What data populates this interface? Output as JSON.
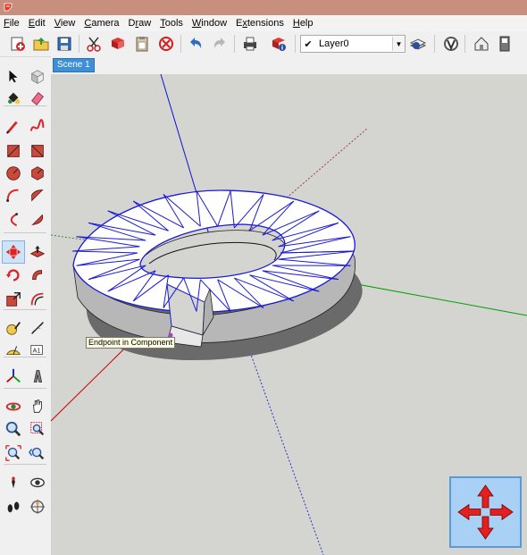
{
  "window": {
    "app_icon": "sketchup-icon"
  },
  "menu": [
    {
      "label": "File",
      "key": "F"
    },
    {
      "label": "Edit",
      "key": "E"
    },
    {
      "label": "View",
      "key": "V"
    },
    {
      "label": "Camera",
      "key": "C"
    },
    {
      "label": "Draw",
      "key": "r"
    },
    {
      "label": "Tools",
      "key": "T"
    },
    {
      "label": "Window",
      "key": "W"
    },
    {
      "label": "Extensions",
      "key": "x"
    },
    {
      "label": "Help",
      "key": "H"
    }
  ],
  "toolbar": {
    "buttons": [
      {
        "icon": "new-model-icon"
      },
      {
        "icon": "open-folder-icon"
      },
      {
        "icon": "save-icon"
      },
      {
        "icon": "cut-icon"
      },
      {
        "icon": "copy-icon"
      },
      {
        "icon": "paste-icon"
      },
      {
        "icon": "erase-icon"
      },
      {
        "icon": "undo-icon"
      },
      {
        "icon": "redo-icon"
      },
      {
        "icon": "print-icon"
      },
      {
        "icon": "model-info-icon"
      }
    ],
    "layer": {
      "current": "Layer0",
      "checked": true
    },
    "right_buttons": [
      {
        "icon": "layer-manager-icon"
      },
      {
        "icon": "vray-icon"
      },
      {
        "icon": "warehouse-icon"
      },
      {
        "icon": "extension-icon"
      }
    ]
  },
  "left_tools": [
    [
      "select-icon",
      "make-component-icon"
    ],
    [
      "paint-bucket-icon",
      "eraser-icon"
    ],
    [
      "pencil-line-icon",
      "freehand-icon"
    ],
    [
      "rectangle-icon",
      "rotated-rectangle-icon"
    ],
    [
      "circle-icon",
      "polygon-icon"
    ],
    [
      "arc-icon",
      "two-point-arc-icon"
    ],
    [
      "three-point-arc-icon",
      "pie-icon"
    ],
    [
      "move-icon",
      "push-pull-icon"
    ],
    [
      "rotate-icon",
      "follow-me-icon"
    ],
    [
      "scale-icon",
      "offset-icon"
    ],
    [
      "tape-measure-icon",
      "dimension-icon"
    ],
    [
      "protractor-icon",
      "text-icon"
    ],
    [
      "axes-icon",
      "3d-text-icon"
    ],
    [
      "orbit-icon",
      "pan-icon"
    ],
    [
      "zoom-icon",
      "zoom-window-icon"
    ],
    [
      "zoom-extents-icon",
      "previous-view-icon"
    ],
    [
      "position-camera-icon",
      "look-around-icon"
    ],
    [
      "walk-icon",
      "section-plane-icon"
    ]
  ],
  "active_tool": "move-icon",
  "scene": {
    "tab_label": "Scene 1"
  },
  "viewport": {
    "tooltip": "Endpoint in Component",
    "nav_widget_icon": "move-arrows-icon"
  },
  "colors": {
    "axis_blue": "#0000e0",
    "axis_red": "#cc0000",
    "axis_green": "#00a000",
    "selection_blue": "#1a1ad6",
    "viewport_bg": "#d4d4d0"
  }
}
